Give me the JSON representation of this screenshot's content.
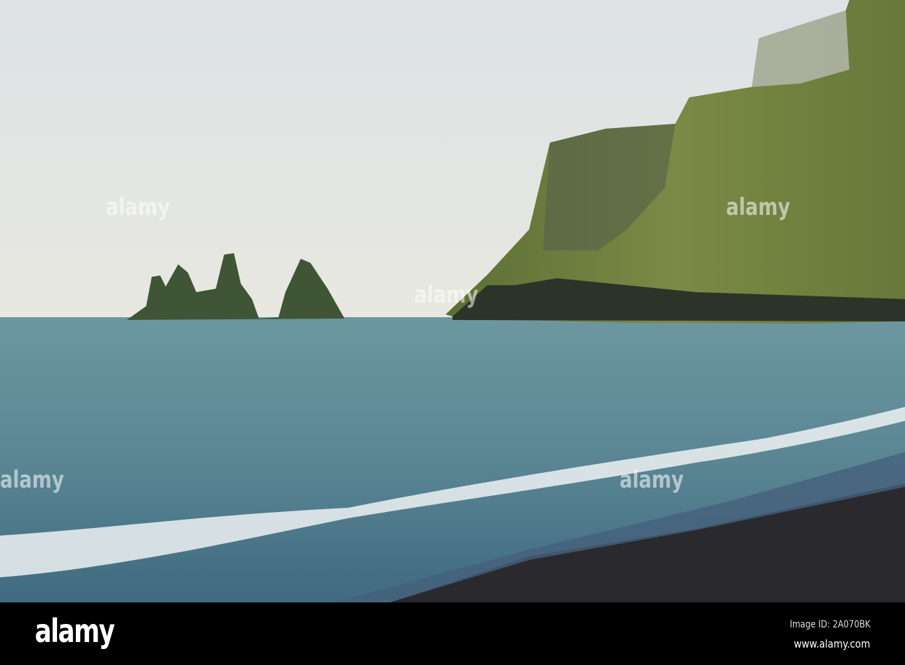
{
  "watermark": {
    "logo_text": "alamy",
    "image_id": "Image ID: 2A070BK",
    "url": "www.alamy.com"
  },
  "colors": {
    "sky": "#e2e5e4",
    "sea": "#5e8a96",
    "cliff": "#6d7f3c",
    "sand": "#2b2b2e",
    "foam": "#f2f4f4"
  }
}
